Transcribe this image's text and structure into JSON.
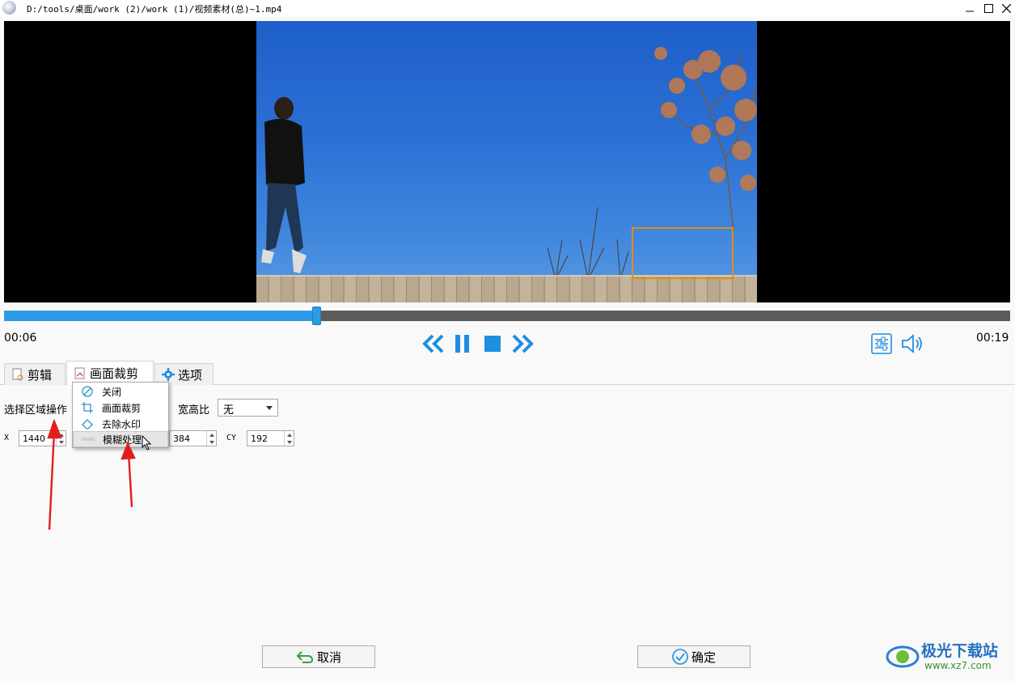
{
  "window": {
    "title": "D:/tools/桌面/work (2)/work (1)/视频素材(总)~1.mp4"
  },
  "player": {
    "current_time": "00:06",
    "total_time": "00:19",
    "progress": 0.31,
    "accent": "#2e9be6"
  },
  "tabs": [
    {
      "label": "剪辑",
      "icon": "scissors-doc-icon"
    },
    {
      "label": "画面裁剪",
      "icon": "crop-doc-icon"
    },
    {
      "label": "选项",
      "icon": "gear-icon"
    }
  ],
  "crop_panel": {
    "region_op_label": "选择区域操作",
    "aspect_label": "宽高比",
    "aspect_value": "无",
    "x_label": "X",
    "x_value": "1440",
    "cx_value": "384",
    "cy_label": "CY",
    "cy_value": "192"
  },
  "dropdown_menu": {
    "items": [
      {
        "label": "关闭",
        "icon": "circle-slash-icon"
      },
      {
        "label": "画面裁剪",
        "icon": "crop-icon"
      },
      {
        "label": "去除水印",
        "icon": "eraser-icon"
      },
      {
        "label": "模糊处理",
        "icon": "blur-icon"
      }
    ],
    "hovered_index": 3
  },
  "buttons": {
    "cancel": "取消",
    "ok": "确定"
  },
  "watermark": {
    "name": "极光下载站",
    "url": "www.xz7.com"
  }
}
